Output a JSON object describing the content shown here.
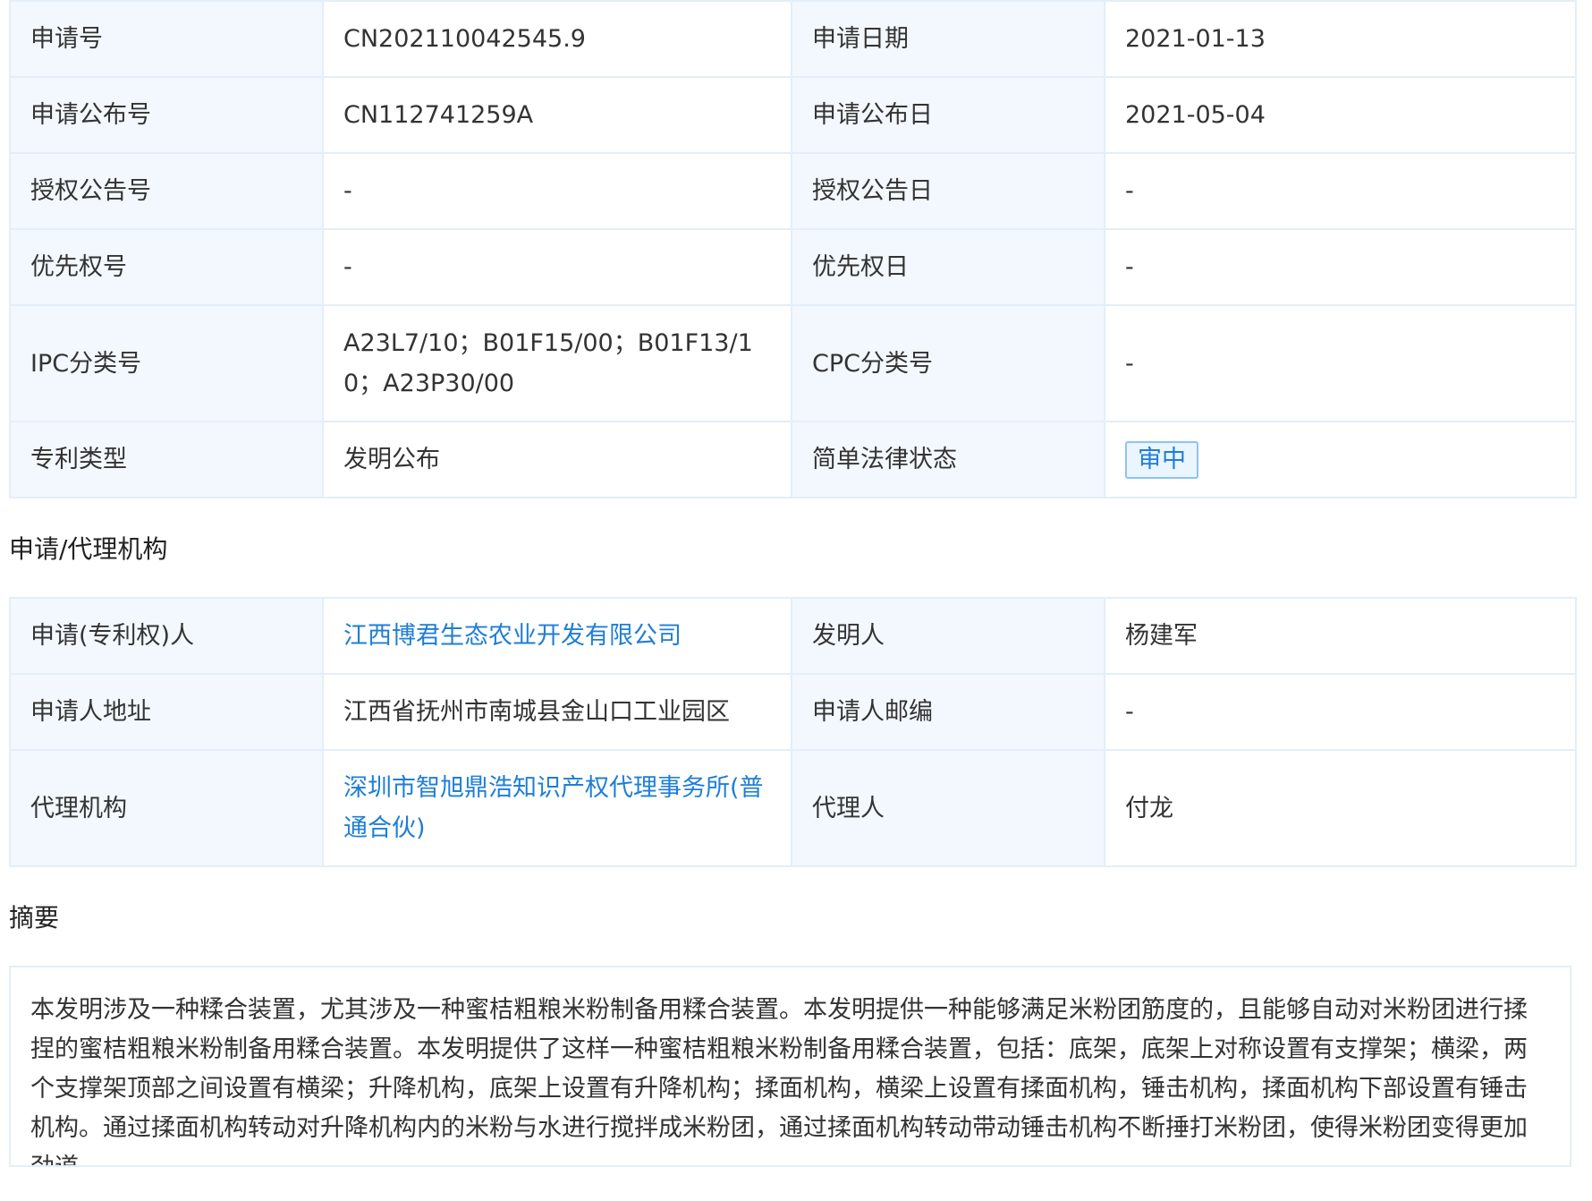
{
  "basic_info": {
    "rows": [
      {
        "l1": "申请号",
        "v1": "CN202110042545.9",
        "l2": "申请日期",
        "v2": "2021-01-13"
      },
      {
        "l1": "申请公布号",
        "v1": "CN112741259A",
        "l2": "申请公布日",
        "v2": "2021-05-04"
      },
      {
        "l1": "授权公告号",
        "v1": "-",
        "l2": "授权公告日",
        "v2": "-"
      },
      {
        "l1": "优先权号",
        "v1": "-",
        "l2": "优先权日",
        "v2": "-"
      },
      {
        "l1": "IPC分类号",
        "v1": "A23L7/10；B01F15/00；B01F13/10；A23P30/00",
        "l2": "CPC分类号",
        "v2": "-"
      },
      {
        "l1": "专利类型",
        "v1": "发明公布",
        "l2": "简单法律状态",
        "v2": "审中"
      }
    ]
  },
  "agency": {
    "title": "申请/代理机构",
    "rows": [
      {
        "l1": "申请(专利权)人",
        "v1": "江西博君生态农业开发有限公司",
        "l2": "发明人",
        "v2": "杨建军"
      },
      {
        "l1": "申请人地址",
        "v1": "江西省抚州市南城县金山口工业园区",
        "l2": "申请人邮编",
        "v2": "-"
      },
      {
        "l1": "代理机构",
        "v1": "深圳市智旭鼎浩知识产权代理事务所(普通合伙)",
        "l2": "代理人",
        "v2": "付龙"
      }
    ]
  },
  "abstract": {
    "title": "摘要",
    "text": "本发明涉及一种糅合装置，尤其涉及一种蜜桔粗粮米粉制备用糅合装置。本发明提供一种能够满足米粉团筋度的，且能够自动对米粉团进行揉捏的蜜桔粗粮米粉制备用糅合装置。本发明提供了这样一种蜜桔粗粮米粉制备用糅合装置，包括：底架，底架上对称设置有支撑架；横梁，两个支撑架顶部之间设置有横梁；升降机构，底架上设置有升降机构；揉面机构，横梁上设置有揉面机构，锤击机构，揉面机构下部设置有锤击机构。通过揉面机构转动对升降机构内的米粉与水进行搅拌成米粉团，通过揉面机构转动带动锤击机构不断捶打米粉团，使得米粉团变得更加劲道。"
  },
  "colors": {
    "label_bg": "#f2f8fe",
    "border": "#e4eef8",
    "link": "#1f7ed6"
  }
}
